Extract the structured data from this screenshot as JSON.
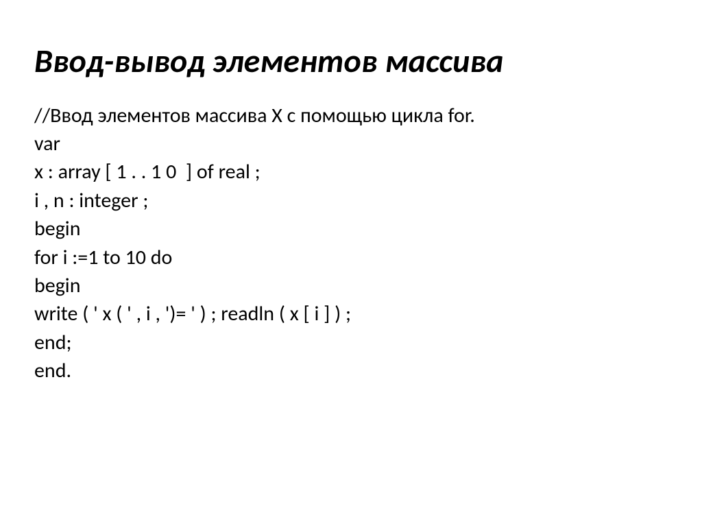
{
  "slide": {
    "title": "Ввод-вывод элементов массива",
    "lines": [
      "//Ввод элементов массива X с помощью цикла for.",
      "var",
      "x : array [ 1 . . 1 0  ] of real ;",
      "i , n : integer ;",
      "begin",
      "for i :=1 to 10 do",
      "begin",
      "write ( ' x ( ' , i , ')= ' ) ; readln ( x [ i ] ) ;",
      "end;",
      "end."
    ]
  }
}
